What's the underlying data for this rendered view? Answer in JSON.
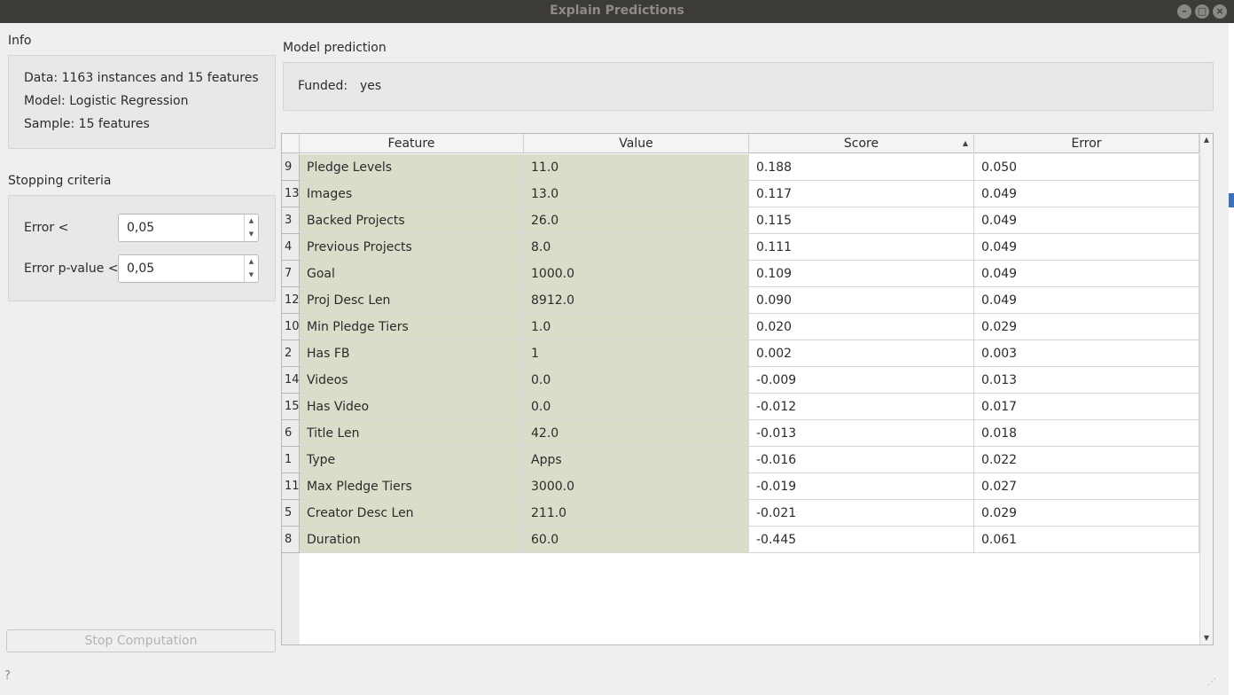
{
  "window": {
    "title": "Explain Predictions",
    "buttons": [
      "–",
      "□",
      "×"
    ]
  },
  "info": {
    "label": "Info",
    "data": "Data: 1163 instances and 15 features",
    "model": "Model: Logistic Regression",
    "sample": "Sample: 15 features"
  },
  "stopping": {
    "label": "Stopping criteria",
    "error_label": "Error <",
    "error_value": "0,05",
    "pvalue_label": "Error p-value <",
    "pvalue_value": "0,05"
  },
  "stop_button": "Stop Computation",
  "help_icon": "?",
  "prediction": {
    "label": "Model prediction",
    "target": "Funded:",
    "value": "yes"
  },
  "table": {
    "columns": [
      "Feature",
      "Value",
      "Score",
      "Error"
    ],
    "sort_column": "Score",
    "rows": [
      {
        "idx": "9",
        "feature": "Pledge Levels",
        "value": "11.0",
        "score": "0.188",
        "error": "0.050"
      },
      {
        "idx": "13",
        "feature": "Images",
        "value": "13.0",
        "score": "0.117",
        "error": "0.049"
      },
      {
        "idx": "3",
        "feature": "Backed Projects",
        "value": "26.0",
        "score": "0.115",
        "error": "0.049"
      },
      {
        "idx": "4",
        "feature": "Previous Projects",
        "value": "8.0",
        "score": "0.111",
        "error": "0.049"
      },
      {
        "idx": "7",
        "feature": "Goal",
        "value": "1000.0",
        "score": "0.109",
        "error": "0.049"
      },
      {
        "idx": "12",
        "feature": "Proj Desc Len",
        "value": "8912.0",
        "score": "0.090",
        "error": "0.049"
      },
      {
        "idx": "10",
        "feature": "Min Pledge Tiers",
        "value": "1.0",
        "score": "0.020",
        "error": "0.029"
      },
      {
        "idx": "2",
        "feature": "Has FB",
        "value": "1",
        "score": "0.002",
        "error": "0.003"
      },
      {
        "idx": "14",
        "feature": "Videos",
        "value": "0.0",
        "score": "-0.009",
        "error": "0.013"
      },
      {
        "idx": "15",
        "feature": "Has Video",
        "value": "0.0",
        "score": "-0.012",
        "error": "0.017"
      },
      {
        "idx": "6",
        "feature": "Title Len",
        "value": "42.0",
        "score": "-0.013",
        "error": "0.018"
      },
      {
        "idx": "1",
        "feature": "Type",
        "value": "Apps",
        "score": "-0.016",
        "error": "0.022"
      },
      {
        "idx": "11",
        "feature": "Max Pledge Tiers",
        "value": "3000.0",
        "score": "-0.019",
        "error": "0.027"
      },
      {
        "idx": "5",
        "feature": "Creator Desc Len",
        "value": "211.0",
        "score": "-0.021",
        "error": "0.029"
      },
      {
        "idx": "8",
        "feature": "Duration",
        "value": "60.0",
        "score": "-0.445",
        "error": "0.061"
      }
    ]
  },
  "colors": {
    "titlebar": "#3c3b37",
    "highlight_cells": "#dcdccb",
    "background": "#efefef"
  }
}
